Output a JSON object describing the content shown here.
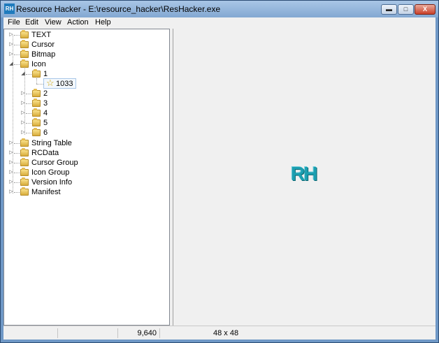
{
  "window": {
    "title": "Resource Hacker - E:\\resource_hacker\\ResHacker.exe",
    "app_icon_text": "RH",
    "min_glyph": "▬",
    "max_glyph": "□",
    "close_glyph": "X"
  },
  "menu": [
    "File",
    "Edit",
    "View",
    "Action",
    "Help"
  ],
  "tree": {
    "top": [
      "TEXT",
      "Cursor",
      "Bitmap",
      "Icon"
    ],
    "icon_children": [
      "1",
      "2",
      "3",
      "4",
      "5",
      "6"
    ],
    "selected_leaf": "1033",
    "bottom": [
      "String Table",
      "RCData",
      "Cursor Group",
      "Icon Group",
      "Version Info",
      "Manifest"
    ],
    "collapsed_glyph": "▷",
    "expanded_glyph": "◢"
  },
  "preview": {
    "logo_text": "RH"
  },
  "status": {
    "size": "9,640",
    "dimensions": "48 x 48"
  },
  "colors": {
    "title_bar": "#83a8d2",
    "frame": "#6f98c6",
    "logo": "#1b9fb1",
    "folder": "#e5bd52"
  }
}
